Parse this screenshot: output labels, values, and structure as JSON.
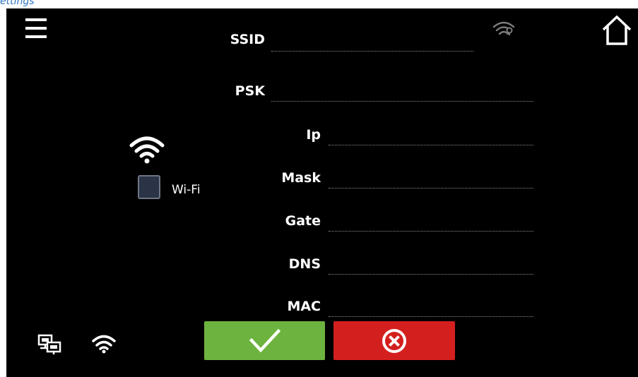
{
  "caption": "ettings",
  "header": {
    "menu_icon": "hamburger-menu-icon",
    "home_icon": "home-icon",
    "wifi_status_icon": "wifi-no-connection-icon"
  },
  "form": {
    "ssid": {
      "label": "SSID",
      "value": ""
    },
    "psk": {
      "label": "PSK",
      "value": ""
    },
    "ip": {
      "label": "Ip",
      "value": ""
    },
    "mask": {
      "label": "Mask",
      "value": ""
    },
    "gate": {
      "label": "Gate",
      "value": ""
    },
    "dns": {
      "label": "DNS",
      "value": ""
    },
    "mac": {
      "label": "MAC",
      "value": ""
    }
  },
  "wifi_toggle": {
    "label": "Wi-Fi",
    "checked": false
  },
  "footer": {
    "network_icon": "ethernet-network-icon",
    "wifi_icon": "wifi-icon",
    "confirm_icon": "checkmark-icon",
    "cancel_icon": "cancel-x-icon"
  },
  "colors": {
    "background": "#000000",
    "confirm": "#6db33f",
    "cancel": "#d3201e",
    "caption": "#2f74c0",
    "checkbox": "#2b3347"
  }
}
